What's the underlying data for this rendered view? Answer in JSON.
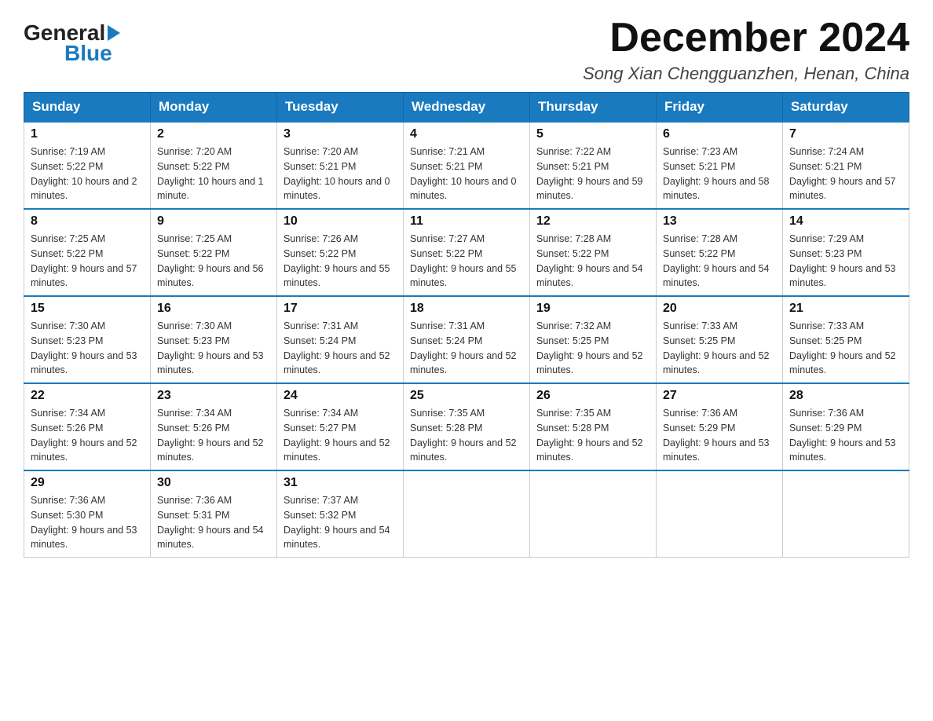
{
  "logo": {
    "general": "General",
    "blue": "Blue"
  },
  "title": "December 2024",
  "subtitle": "Song Xian Chengguanzhen, Henan, China",
  "days_of_week": [
    "Sunday",
    "Monday",
    "Tuesday",
    "Wednesday",
    "Thursday",
    "Friday",
    "Saturday"
  ],
  "weeks": [
    [
      {
        "day": "1",
        "sunrise": "7:19 AM",
        "sunset": "5:22 PM",
        "daylight": "10 hours and 2 minutes."
      },
      {
        "day": "2",
        "sunrise": "7:20 AM",
        "sunset": "5:22 PM",
        "daylight": "10 hours and 1 minute."
      },
      {
        "day": "3",
        "sunrise": "7:20 AM",
        "sunset": "5:21 PM",
        "daylight": "10 hours and 0 minutes."
      },
      {
        "day": "4",
        "sunrise": "7:21 AM",
        "sunset": "5:21 PM",
        "daylight": "10 hours and 0 minutes."
      },
      {
        "day": "5",
        "sunrise": "7:22 AM",
        "sunset": "5:21 PM",
        "daylight": "9 hours and 59 minutes."
      },
      {
        "day": "6",
        "sunrise": "7:23 AM",
        "sunset": "5:21 PM",
        "daylight": "9 hours and 58 minutes."
      },
      {
        "day": "7",
        "sunrise": "7:24 AM",
        "sunset": "5:21 PM",
        "daylight": "9 hours and 57 minutes."
      }
    ],
    [
      {
        "day": "8",
        "sunrise": "7:25 AM",
        "sunset": "5:22 PM",
        "daylight": "9 hours and 57 minutes."
      },
      {
        "day": "9",
        "sunrise": "7:25 AM",
        "sunset": "5:22 PM",
        "daylight": "9 hours and 56 minutes."
      },
      {
        "day": "10",
        "sunrise": "7:26 AM",
        "sunset": "5:22 PM",
        "daylight": "9 hours and 55 minutes."
      },
      {
        "day": "11",
        "sunrise": "7:27 AM",
        "sunset": "5:22 PM",
        "daylight": "9 hours and 55 minutes."
      },
      {
        "day": "12",
        "sunrise": "7:28 AM",
        "sunset": "5:22 PM",
        "daylight": "9 hours and 54 minutes."
      },
      {
        "day": "13",
        "sunrise": "7:28 AM",
        "sunset": "5:22 PM",
        "daylight": "9 hours and 54 minutes."
      },
      {
        "day": "14",
        "sunrise": "7:29 AM",
        "sunset": "5:23 PM",
        "daylight": "9 hours and 53 minutes."
      }
    ],
    [
      {
        "day": "15",
        "sunrise": "7:30 AM",
        "sunset": "5:23 PM",
        "daylight": "9 hours and 53 minutes."
      },
      {
        "day": "16",
        "sunrise": "7:30 AM",
        "sunset": "5:23 PM",
        "daylight": "9 hours and 53 minutes."
      },
      {
        "day": "17",
        "sunrise": "7:31 AM",
        "sunset": "5:24 PM",
        "daylight": "9 hours and 52 minutes."
      },
      {
        "day": "18",
        "sunrise": "7:31 AM",
        "sunset": "5:24 PM",
        "daylight": "9 hours and 52 minutes."
      },
      {
        "day": "19",
        "sunrise": "7:32 AM",
        "sunset": "5:25 PM",
        "daylight": "9 hours and 52 minutes."
      },
      {
        "day": "20",
        "sunrise": "7:33 AM",
        "sunset": "5:25 PM",
        "daylight": "9 hours and 52 minutes."
      },
      {
        "day": "21",
        "sunrise": "7:33 AM",
        "sunset": "5:25 PM",
        "daylight": "9 hours and 52 minutes."
      }
    ],
    [
      {
        "day": "22",
        "sunrise": "7:34 AM",
        "sunset": "5:26 PM",
        "daylight": "9 hours and 52 minutes."
      },
      {
        "day": "23",
        "sunrise": "7:34 AM",
        "sunset": "5:26 PM",
        "daylight": "9 hours and 52 minutes."
      },
      {
        "day": "24",
        "sunrise": "7:34 AM",
        "sunset": "5:27 PM",
        "daylight": "9 hours and 52 minutes."
      },
      {
        "day": "25",
        "sunrise": "7:35 AM",
        "sunset": "5:28 PM",
        "daylight": "9 hours and 52 minutes."
      },
      {
        "day": "26",
        "sunrise": "7:35 AM",
        "sunset": "5:28 PM",
        "daylight": "9 hours and 52 minutes."
      },
      {
        "day": "27",
        "sunrise": "7:36 AM",
        "sunset": "5:29 PM",
        "daylight": "9 hours and 53 minutes."
      },
      {
        "day": "28",
        "sunrise": "7:36 AM",
        "sunset": "5:29 PM",
        "daylight": "9 hours and 53 minutes."
      }
    ],
    [
      {
        "day": "29",
        "sunrise": "7:36 AM",
        "sunset": "5:30 PM",
        "daylight": "9 hours and 53 minutes."
      },
      {
        "day": "30",
        "sunrise": "7:36 AM",
        "sunset": "5:31 PM",
        "daylight": "9 hours and 54 minutes."
      },
      {
        "day": "31",
        "sunrise": "7:37 AM",
        "sunset": "5:32 PM",
        "daylight": "9 hours and 54 minutes."
      },
      null,
      null,
      null,
      null
    ]
  ]
}
